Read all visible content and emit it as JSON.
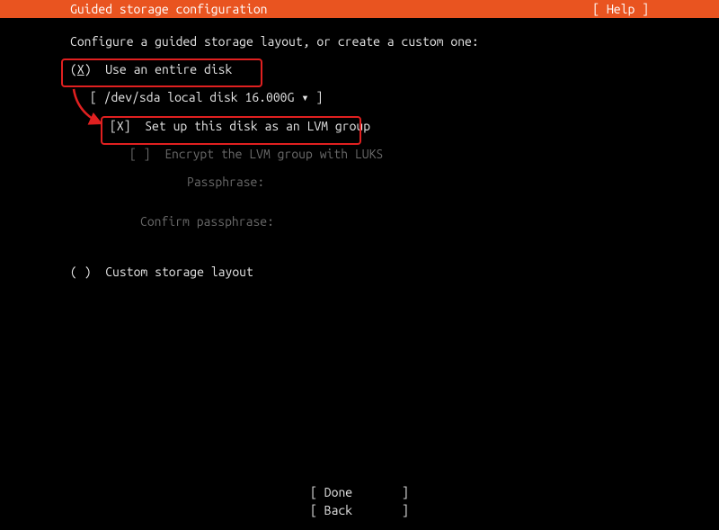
{
  "header": {
    "title": "Guided storage configuration",
    "help": "[ Help ]"
  },
  "intro": "Configure a guided storage layout, or create a custom one:",
  "options": {
    "entire_disk": {
      "radio": "(",
      "radio_mark": "X",
      "radio_close": ")",
      "label": "Use an entire disk"
    },
    "disk_select": {
      "open": "[",
      "value": " /dev/sda local disk 16.000G ",
      "arrow": "▾",
      "close": " ]"
    },
    "lvm": {
      "check": "[X]",
      "label": "Set up this disk as an LVM group"
    },
    "encrypt": {
      "check": "[ ]",
      "label": "Encrypt the LVM group with LUKS"
    },
    "passphrase_label": "Passphrase:",
    "confirm_label": "Confirm passphrase:",
    "custom": {
      "radio": "( )",
      "label": "Custom storage layout"
    }
  },
  "buttons": {
    "done": "[ Done       ]",
    "back": "[ Back       ]"
  }
}
